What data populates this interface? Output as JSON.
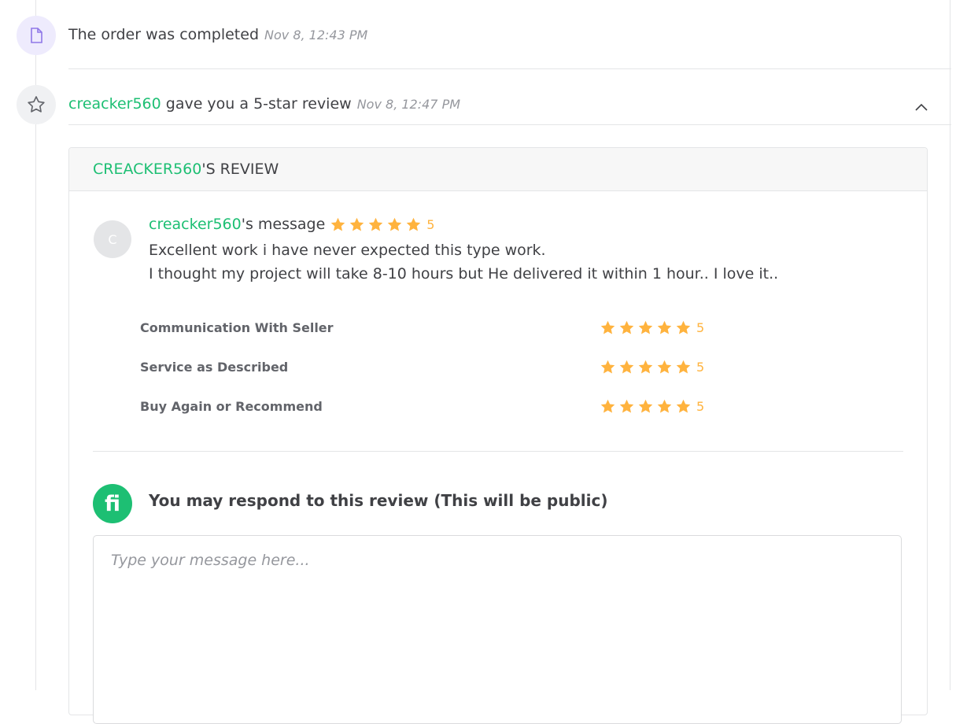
{
  "events": [
    {
      "icon": "document-icon",
      "text": "The order was completed",
      "time": "Nov 8, 12:43 PM"
    },
    {
      "icon": "star-outline-icon",
      "user": "creacker560",
      "text": " gave you a 5-star review",
      "time": "Nov 8, 12:47 PM"
    }
  ],
  "review": {
    "header_user": "CREACKER560",
    "header_suffix": "'S REVIEW",
    "avatar_initial": "C",
    "message_user": "creacker560",
    "message_suffix": "'s message",
    "overall_rating": "5",
    "message_lines": [
      "Excellent work i have never expected this type work.",
      "I thought my project will take 8-10 hours but He delivered it within 1 hour.. I love it.."
    ],
    "criteria": [
      {
        "label": "Communication With Seller",
        "rating": "5"
      },
      {
        "label": "Service as Described",
        "rating": "5"
      },
      {
        "label": "Buy Again or Recommend",
        "rating": "5"
      }
    ]
  },
  "respond": {
    "logo_text": "fi",
    "title": "You may respond to this review (This will be public)",
    "placeholder": "Type your message here..."
  },
  "colors": {
    "accent_green": "#1dbf73",
    "star_orange": "#ffb33e",
    "icon_purple": "#8f78e8",
    "icon_purple_bg": "#eeebfd"
  }
}
